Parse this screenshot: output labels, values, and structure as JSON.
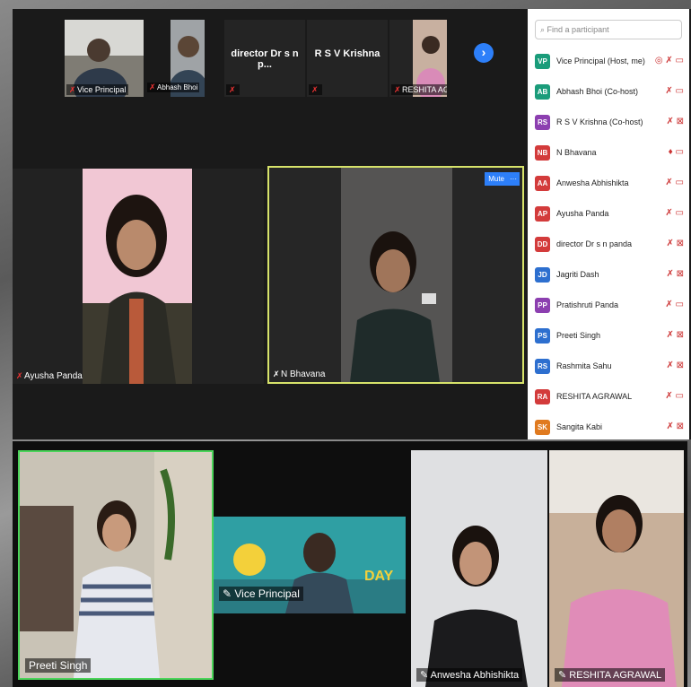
{
  "top_strip": {
    "thumbs": [
      {
        "label": "Vice Principal"
      },
      {
        "label": "Abhash Bhoi"
      },
      {
        "name": "director Dr s n p..."
      },
      {
        "name": "R S V Krishna"
      },
      {
        "label": "RESHITA AGR..."
      }
    ]
  },
  "main_videos": {
    "left_label": "Ayusha Panda",
    "right_label": "N Bhavana",
    "mute_button": "Mute",
    "more_button": "···"
  },
  "participants": {
    "search_placeholder": "Find a participant",
    "list": [
      {
        "initials": "VP",
        "name": "Vice Principal (Host, me)",
        "color": "#1a9c7a"
      },
      {
        "initials": "AB",
        "name": "Abhash Bhoi (Co-host)",
        "color": "#1a9c7a"
      },
      {
        "initials": "RS",
        "name": "R S V Krishna (Co-host)",
        "color": "#8c3fb0"
      },
      {
        "initials": "NB",
        "name": "N Bhavana",
        "color": "#d33b3b"
      },
      {
        "initials": "AA",
        "name": "Anwesha Abhishikta",
        "color": "#d33b3b"
      },
      {
        "initials": "AP",
        "name": "Ayusha Panda",
        "color": "#d33b3b"
      },
      {
        "initials": "DD",
        "name": "director Dr s n panda",
        "color": "#d33b3b"
      },
      {
        "initials": "JD",
        "name": "Jagriti Dash",
        "color": "#2d6fcf"
      },
      {
        "initials": "PP",
        "name": "Pratishruti Panda",
        "color": "#8c3fb0"
      },
      {
        "initials": "PS",
        "name": "Preeti Singh",
        "color": "#2d6fcf"
      },
      {
        "initials": "RS",
        "name": "Rashmita Sahu",
        "color": "#2d6fcf"
      },
      {
        "initials": "RA",
        "name": "RESHITA AGRAWAL",
        "color": "#d33b3b"
      },
      {
        "initials": "SK",
        "name": "Sangita Kabi",
        "color": "#e07a1f"
      }
    ]
  },
  "bottom_videos": {
    "preeti": "Preeti Singh",
    "vice": "Vice Principal",
    "anwesha": "Anwesha Abhishikta",
    "reshita": "RESHITA AGRAWAL",
    "banner_text": "DAY"
  }
}
